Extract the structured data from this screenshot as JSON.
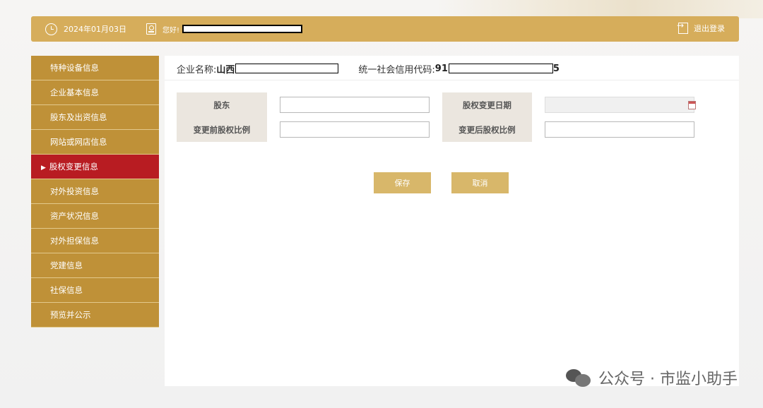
{
  "header": {
    "date": "2024年01月03日",
    "greeting": "您好!",
    "logout_label": "退出登录"
  },
  "sidebar": {
    "items": [
      {
        "label": "特种设备信息"
      },
      {
        "label": "企业基本信息"
      },
      {
        "label": "股东及出资信息"
      },
      {
        "label": "网站或网店信息"
      },
      {
        "label": "股权变更信息",
        "active": true
      },
      {
        "label": "对外投资信息"
      },
      {
        "label": "资产状况信息"
      },
      {
        "label": "对外担保信息"
      },
      {
        "label": "党建信息"
      },
      {
        "label": "社保信息"
      },
      {
        "label": "预览并公示"
      }
    ]
  },
  "company": {
    "name_label": "企业名称:",
    "name_value": "山西",
    "credit_label": "统一社会信用代码:",
    "credit_value": "91",
    "credit_suffix": "5"
  },
  "form": {
    "shareholder_label": "股东",
    "shareholder_value": "",
    "change_date_label": "股权变更日期",
    "change_date_value": "",
    "before_ratio_label": "变更前股权比例",
    "before_ratio_value": "",
    "after_ratio_label": "变更后股权比例",
    "after_ratio_value": ""
  },
  "buttons": {
    "save_label": "保存",
    "cancel_label": "取消"
  },
  "watermark": {
    "text": "公众号 · 市监小助手"
  },
  "colors": {
    "gold": "#d6ad5b",
    "sidebar_gold": "#bf9138",
    "active_red": "#b81c22",
    "button_gold": "#d8b76a"
  }
}
